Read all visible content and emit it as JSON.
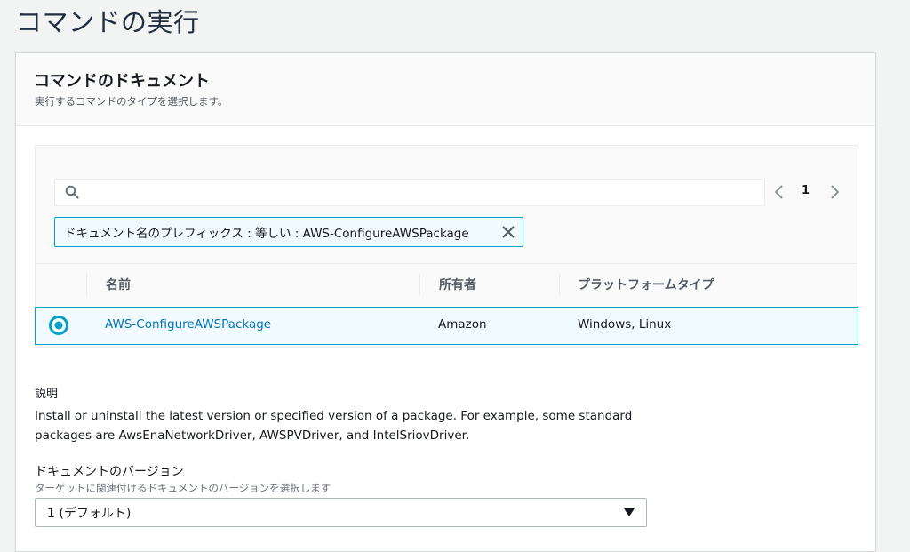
{
  "page": {
    "title": "コマンドの実行"
  },
  "document_panel": {
    "title": "コマンドのドキュメント",
    "description": "実行するコマンドのタイプを選択します。"
  },
  "search": {
    "value": "",
    "placeholder": ""
  },
  "pagination": {
    "current_page": "1"
  },
  "filter": {
    "text": "ドキュメント名のプレフィックス : 等しい : AWS-ConfigureAWSPackage"
  },
  "table": {
    "columns": [
      "名前",
      "所有者",
      "プラットフォームタイプ"
    ],
    "rows": [
      {
        "name": "AWS-ConfigureAWSPackage",
        "owner": "Amazon",
        "platform": "Windows, Linux",
        "selected": true
      }
    ]
  },
  "details": {
    "description_label": "説明",
    "description": "Install or uninstall the latest version or specified version of a package. For example, some standard packages are AwsEnaNetworkDriver, AWSPVDriver, and IntelSriovDriver."
  },
  "version": {
    "label": "ドキュメントのバージョン",
    "hint": "ターゲットに関連付けるドキュメントのバージョンを選択します",
    "selected": "1 (デフォルト)"
  },
  "icons": {
    "search": "search-icon",
    "prev": "chevron-left-icon",
    "next": "chevron-right-icon",
    "remove": "close-icon",
    "radio": "radio-selected-icon",
    "dropdown": "caret-down-icon"
  },
  "colors": {
    "accent": "#00a1c9",
    "link": "#0073bb",
    "selected_bg": "#f1faff"
  }
}
